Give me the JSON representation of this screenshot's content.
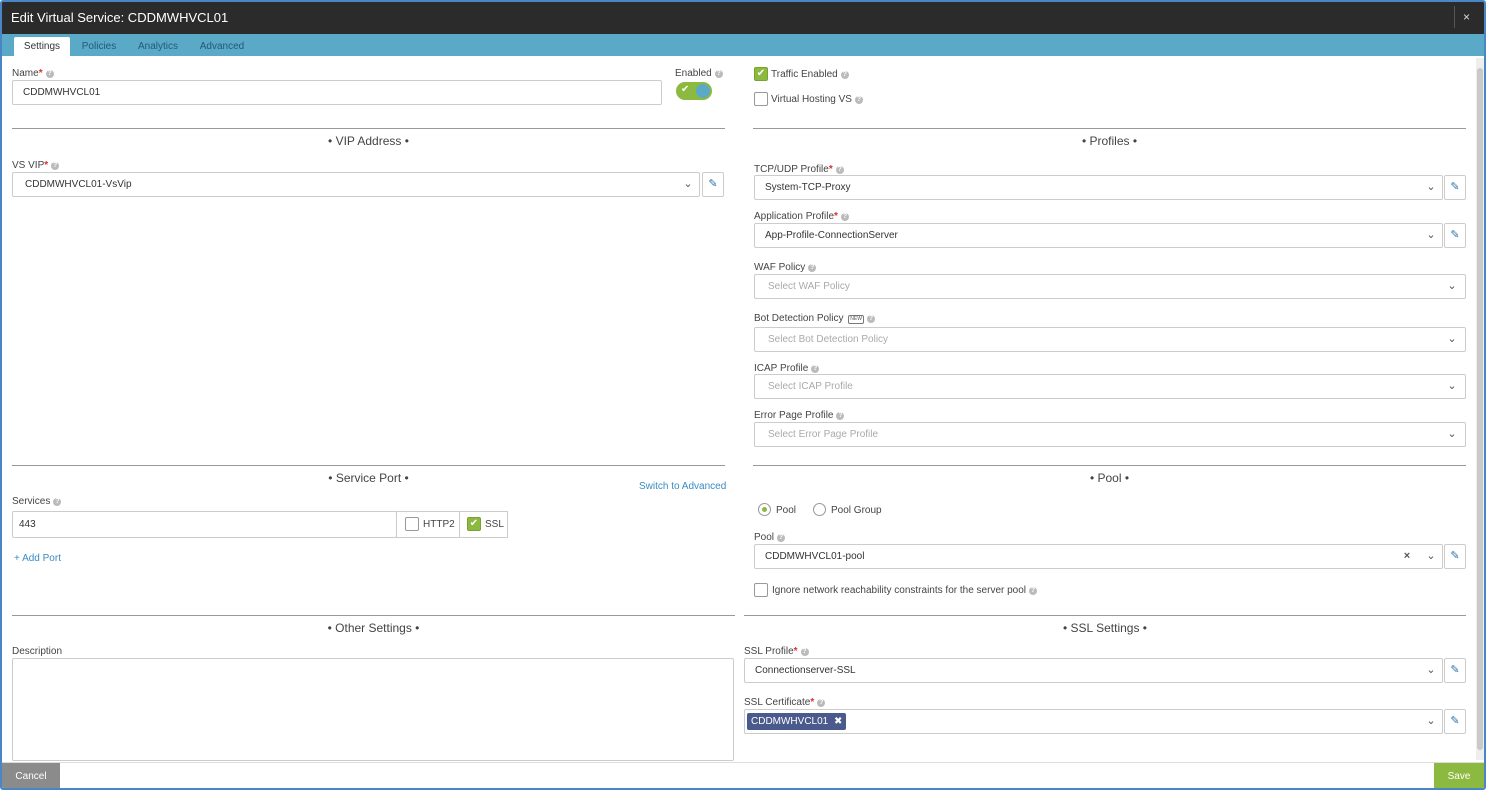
{
  "modal": {
    "title": "Edit Virtual Service: CDDMWHVCL01",
    "close_symbol": "×"
  },
  "tabs": [
    {
      "label": "Settings"
    },
    {
      "label": "Policies"
    },
    {
      "label": "Analytics"
    },
    {
      "label": "Advanced"
    }
  ],
  "name": {
    "label": "Name",
    "value": "CDDMWHVCL01"
  },
  "enabled": {
    "label": "Enabled",
    "on": true
  },
  "traffic_enabled": {
    "label": "Traffic Enabled",
    "checked": true
  },
  "virtual_hosting": {
    "label": "Virtual Hosting VS",
    "checked": false
  },
  "vip_section": {
    "title": "• VIP Address •"
  },
  "vs_vip": {
    "label": "VS VIP",
    "value": "CDDMWHVCL01-VsVip"
  },
  "profiles_section": {
    "title": "• Profiles •"
  },
  "tcp_udp_profile": {
    "label": "TCP/UDP Profile",
    "value": "System-TCP-Proxy"
  },
  "application_profile": {
    "label": "Application Profile",
    "value": "App-Profile-ConnectionServer"
  },
  "waf_policy": {
    "label": "WAF Policy",
    "placeholder": "Select WAF Policy"
  },
  "bot_detection": {
    "label": "Bot Detection Policy",
    "badge": "NEW",
    "placeholder": "Select Bot Detection Policy"
  },
  "icap_profile": {
    "label": "ICAP Profile",
    "placeholder": "Select ICAP Profile"
  },
  "error_page_profile": {
    "label": "Error Page Profile",
    "placeholder": "Select Error Page Profile"
  },
  "service_port_section": {
    "title": "• Service Port •",
    "switch_link": "Switch to Advanced"
  },
  "services": {
    "label": "Services",
    "port": "443",
    "http2_label": "HTTP2",
    "http2_checked": false,
    "ssl_label": "SSL",
    "ssl_checked": true,
    "add_port": "+ Add Port"
  },
  "pool_section": {
    "title": "• Pool •"
  },
  "pool_type": {
    "pool_label": "Pool",
    "pool_group_label": "Pool Group",
    "selected": "Pool"
  },
  "pool": {
    "label": "Pool",
    "value": "CDDMWHVCL01-pool",
    "clear_symbol": "×"
  },
  "ignore_reachability": {
    "label": "Ignore network reachability constraints for the server pool",
    "checked": false
  },
  "other_section": {
    "title": "• Other Settings •"
  },
  "description": {
    "label": "Description",
    "value": ""
  },
  "ssl_section": {
    "title": "• SSL Settings •"
  },
  "ssl_profile": {
    "label": "SSL Profile",
    "value": "Connectionserver-SSL"
  },
  "ssl_certificate": {
    "label": "SSL Certificate",
    "chip": "CDDMWHVCL01",
    "chip_remove": "✖"
  },
  "footer": {
    "cancel_label": "Cancel",
    "save_label": "Save"
  },
  "colors": {
    "accent_tab": "#5aa9c7",
    "success": "#8cb93f",
    "title_bar": "#2b2b2b",
    "link": "#3a8bbf",
    "required": "#d9302c"
  }
}
